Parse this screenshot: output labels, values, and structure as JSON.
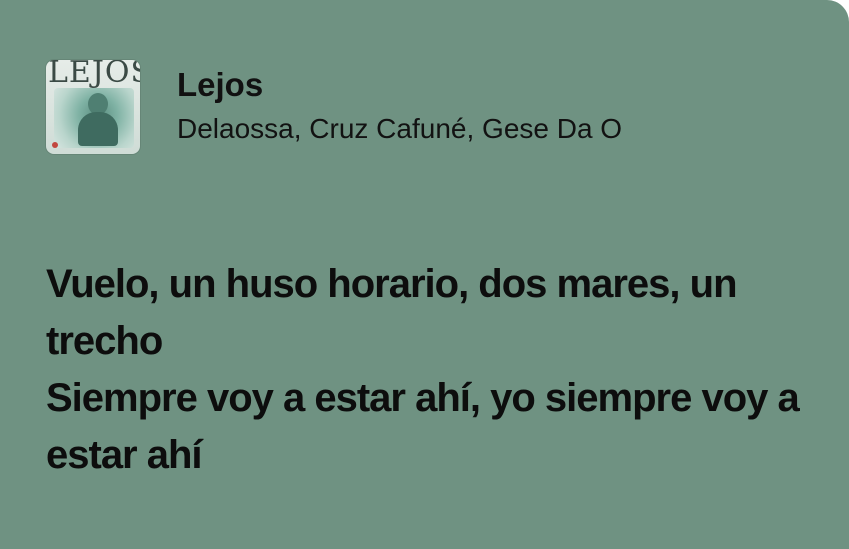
{
  "track": {
    "title": "Lejos",
    "artists": "Delaossa, Cruz Cafuné, Gese Da O",
    "cover_text": "LEJOS"
  },
  "lyrics": [
    "Vuelo, un huso horario, dos mares, un trecho",
    "Siempre voy a estar ahí, yo siempre voy a estar ahí"
  ],
  "colors": {
    "card_background": "#6f9282",
    "text": "#111111"
  }
}
